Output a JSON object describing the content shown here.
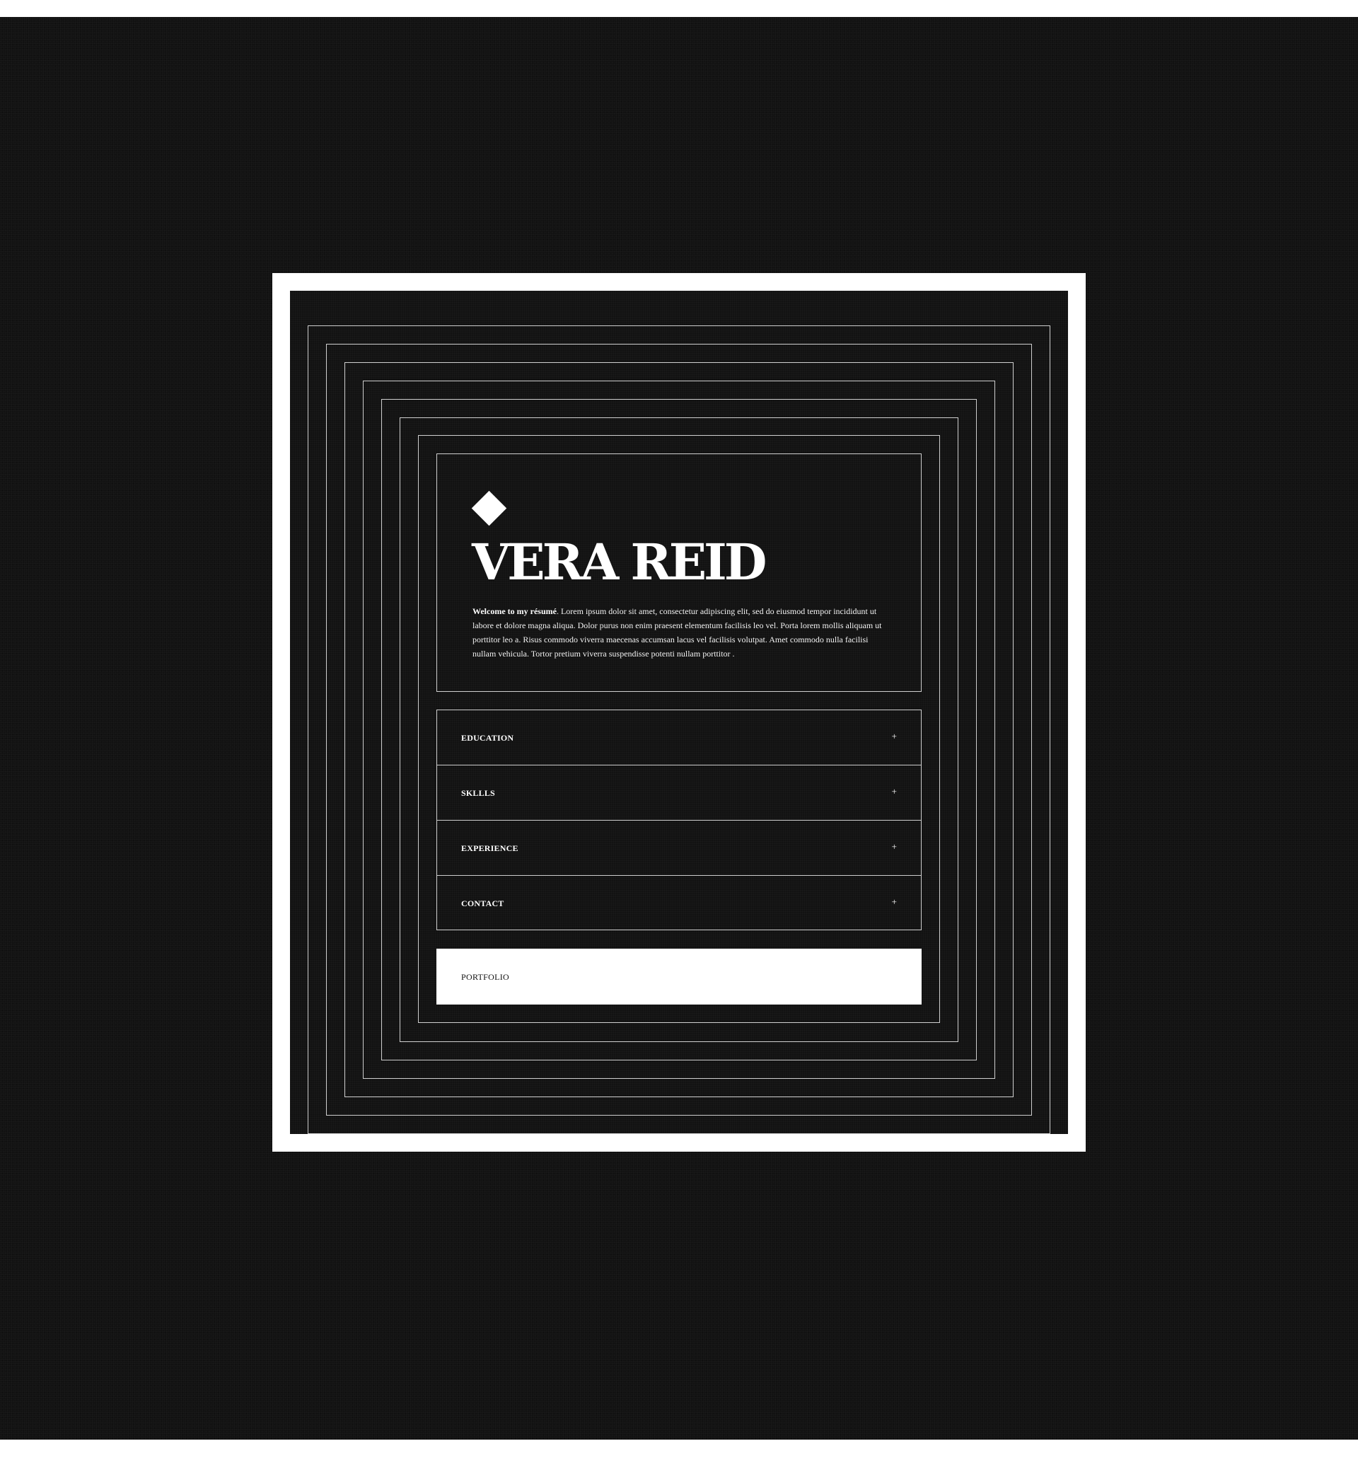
{
  "hero": {
    "name": "VERA REID",
    "intro_bold": "Welcome to my résumé",
    "intro_text": ". Lorem ipsum dolor sit amet, consectetur adipiscing elit, sed do eiusmod tempor incididunt ut labore et dolore magna aliqua. Dolor purus non enim praesent elementum facilisis leo vel. Porta lorem mollis aliquam ut porttitor leo a. Risus commodo viverra maecenas accumsan lacus vel facilisis volutpat. Amet commodo nulla facilisi nullam vehicula. Tortor pretium viverra suspendisse potenti nullam porttitor  ."
  },
  "accordion": {
    "items": [
      {
        "label": "EDUCATION",
        "icon": "+"
      },
      {
        "label": "SKLLLS",
        "icon": "+"
      },
      {
        "label": "EXPERIENCE",
        "icon": "+"
      },
      {
        "label": "CONTACT",
        "icon": "+"
      }
    ]
  },
  "portfolio": {
    "label": "PORTFOLIO"
  },
  "colors": {
    "background": "#121212",
    "frame": "#ffffff",
    "line": "#cfcfcf",
    "text": "#ffffff"
  }
}
